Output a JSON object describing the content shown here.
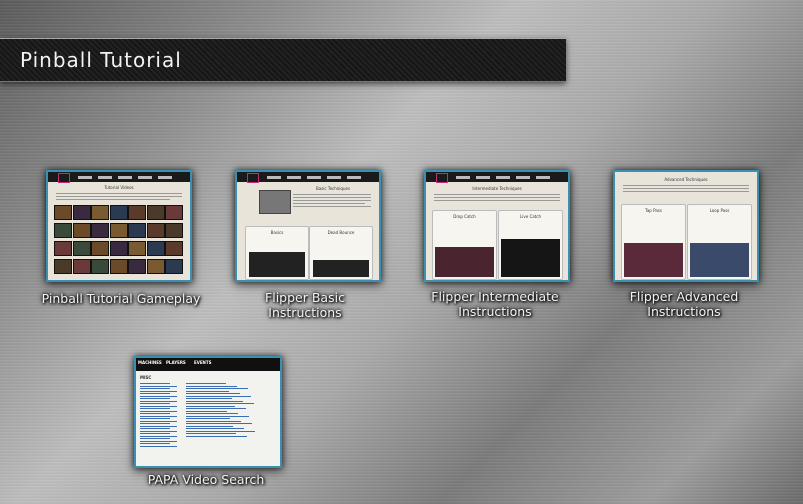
{
  "header": {
    "title": "Pinball Tutorial"
  },
  "tiles": [
    {
      "caption": "Pinball Tutorial Gameplay"
    },
    {
      "caption": "Flipper Basic Instructions"
    },
    {
      "caption": "Flipper Intermediate Instructions"
    },
    {
      "caption": "Flipper Advanced Instructions"
    },
    {
      "caption": "PAPA Video Search"
    }
  ],
  "thumbnails": {
    "gameplay": {
      "heading": "Tutorial Videos"
    },
    "basic": {
      "heading": "Basic Techniques",
      "panel_left": "Basics",
      "panel_right": "Dead Bounce"
    },
    "intermediate": {
      "heading": "Intermediate Techniques",
      "panel_left": "Drop Catch",
      "panel_right": "Live Catch"
    },
    "advanced": {
      "heading": "Advanced Techniques",
      "panel_left": "Tap Pass",
      "panel_right": "Loop Pass"
    },
    "papa": {
      "tab1": "MACHINES",
      "tab2": "PLAYERS",
      "tab3": "EVENTS",
      "section": "MISC"
    }
  },
  "colors": {
    "accent_border": "#3b8fb0",
    "title_bar": "#1b1b1b",
    "caption_text": "#f3f3f3"
  }
}
